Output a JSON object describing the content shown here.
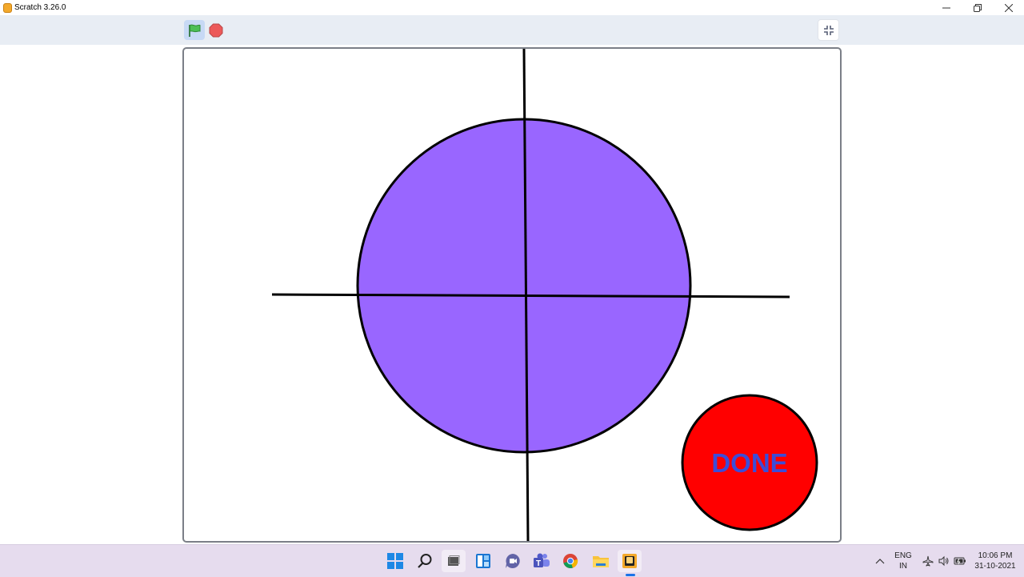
{
  "window": {
    "title": "Scratch 3.26.0",
    "controls": [
      "minimize-icon",
      "restore-icon",
      "close-icon"
    ]
  },
  "toolbar": {
    "green_flag": "green-flag-icon",
    "stop": "stop-icon",
    "fullscreen_toggle": "exit-fullscreen-icon"
  },
  "stage": {
    "circle_color": "#9966ff",
    "done_button": {
      "label": "DONE",
      "fill": "#ff0000",
      "text_color": "#3c4dd8"
    }
  },
  "taskbar": {
    "apps": [
      "windows-start-icon",
      "search-icon",
      "task-view-icon",
      "widgets-icon",
      "chat-icon",
      "teams-icon",
      "chrome-icon",
      "file-explorer-icon",
      "scratch-icon"
    ],
    "lang_line1": "ENG",
    "lang_line2": "IN",
    "time": "10:06 PM",
    "date": "31-10-2021"
  }
}
